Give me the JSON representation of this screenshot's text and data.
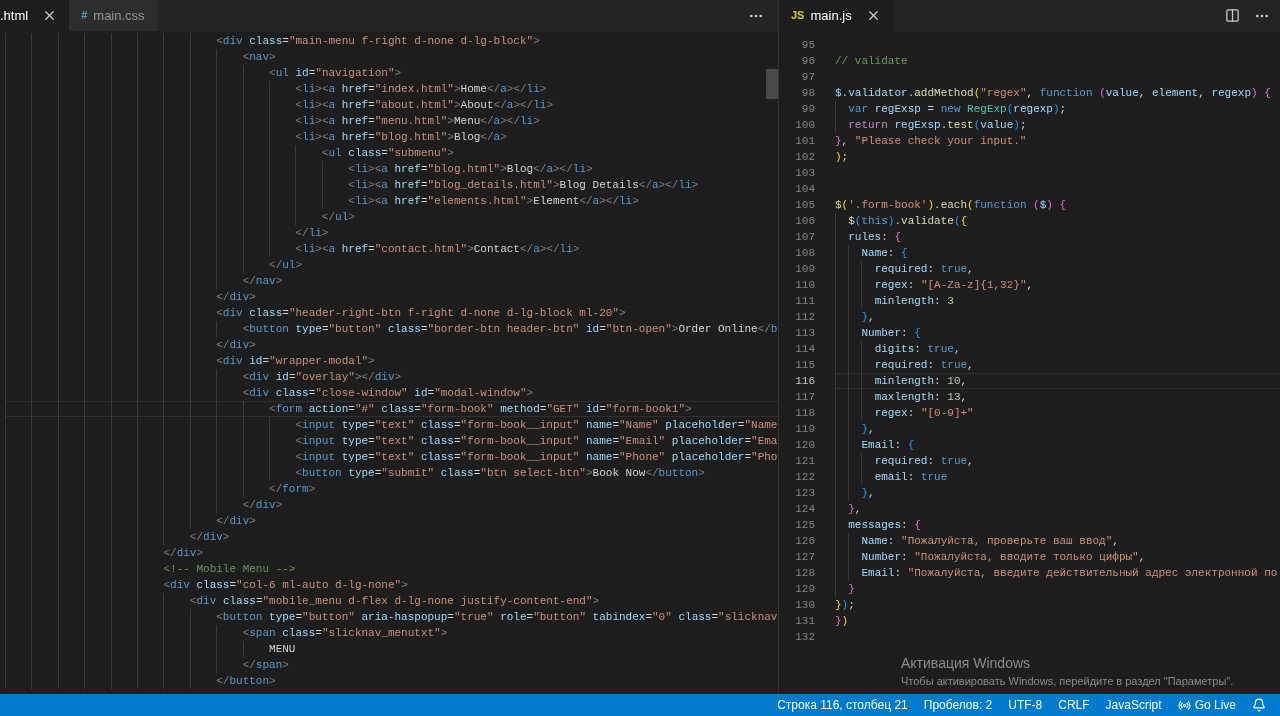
{
  "left_editor": {
    "tabs": [
      {
        "label": ".html",
        "selected": true
      },
      {
        "label": "main.css",
        "glyph": "#",
        "color": "#519aba",
        "selected": false
      }
    ],
    "lines": [
      {
        "code": "                                <div class=\"main-menu f-right d-none d-lg-block\">",
        "current": false
      },
      {
        "code": "                                    <nav>",
        "current": false
      },
      {
        "code": "                                        <ul id=\"navigation\">",
        "current": false
      },
      {
        "code": "                                            <li><a href=\"index.html\">Home</a></li>",
        "current": false
      },
      {
        "code": "                                            <li><a href=\"about.html\">About</a></li>",
        "current": false
      },
      {
        "code": "                                            <li><a href=\"menu.html\">Menu</a></li>",
        "current": false
      },
      {
        "code": "                                            <li><a href=\"blog.html\">Blog</a>",
        "current": false
      },
      {
        "code": "                                                <ul class=\"submenu\">",
        "current": false
      },
      {
        "code": "                                                    <li><a href=\"blog.html\">Blog</a></li>",
        "current": false
      },
      {
        "code": "                                                    <li><a href=\"blog_details.html\">Blog Details</a></li>",
        "current": false
      },
      {
        "code": "                                                    <li><a href=\"elements.html\">Element</a></li>",
        "current": false
      },
      {
        "code": "                                                </ul>",
        "current": false
      },
      {
        "code": "                                            </li>",
        "current": false
      },
      {
        "code": "                                            <li><a href=\"contact.html\">Contact</a></li>",
        "current": false
      },
      {
        "code": "                                        </ul>",
        "current": false
      },
      {
        "code": "                                    </nav>",
        "current": false
      },
      {
        "code": "                                </div>",
        "current": false
      },
      {
        "code": "                                <div class=\"header-right-btn f-right d-none d-lg-block ml-20\">",
        "current": false
      },
      {
        "code": "                                    <button type=\"button\" class=\"border-btn header-btn\" id=\"btn-open\">Order Online</b",
        "current": false
      },
      {
        "code": "                                </div>",
        "current": false
      },
      {
        "code": "                                <div id=\"wrapper-modal\">",
        "current": false
      },
      {
        "code": "                                    <div id=\"overlay\"></div>",
        "current": false
      },
      {
        "code": "                                    <div class=\"close-window\" id=\"modal-window\">",
        "current": false
      },
      {
        "code": "                                        <form action=\"#\" class=\"form-book\" method=\"GET\" id=\"form-book1\">",
        "current": true
      },
      {
        "code": "                                            <input type=\"text\" class=\"form-book__input\" name=\"Name\" placeholder=\"Name",
        "current": false
      },
      {
        "code": "                                            <input type=\"text\" class=\"form-book__input\" name=\"Email\" placeholder=\"Ema",
        "current": false
      },
      {
        "code": "                                            <input type=\"text\" class=\"form-book__input\" name=\"Phone\" placeholder=\"Pho",
        "current": false
      },
      {
        "code": "                                            <button type=\"submit\" class=\"btn select-btn\">Book Now</button>",
        "current": false
      },
      {
        "code": "                                        </form>",
        "current": false
      },
      {
        "code": "                                    </div>",
        "current": false
      },
      {
        "code": "                                </div>",
        "current": false
      },
      {
        "code": "                            </div>",
        "current": false
      },
      {
        "code": "                        </div>",
        "current": false
      },
      {
        "code": "                        <!-- Mobile Menu -->",
        "current": false
      },
      {
        "code": "                        <div class=\"col-6 ml-auto d-lg-none\">",
        "current": false
      },
      {
        "code": "                            <div class=\"mobile_menu d-flex d-lg-none justify-content-end\">",
        "current": false
      },
      {
        "code": "                                <button type=\"button\" aria-haspopup=\"true\" role=\"button\" tabindex=\"0\" class=\"slicknav",
        "current": false
      },
      {
        "code": "                                    <span class=\"slicknav_menutxt\">",
        "current": false
      },
      {
        "code": "                                        MENU",
        "current": false
      },
      {
        "code": "                                    </span>",
        "current": false
      },
      {
        "code": "                                </button>",
        "current": false
      }
    ]
  },
  "right_editor": {
    "tabs": [
      {
        "label": "main.js",
        "glyph": "JS",
        "color": "#cbcb41",
        "selected": true
      }
    ],
    "lines": [
      {
        "number": "95",
        "current": false
      },
      {
        "number": "96",
        "code": "// validate",
        "current": false
      },
      {
        "number": "97",
        "current": false
      },
      {
        "number": "98",
        "code": "$.validator.addMethod(\"regex\", function (value, element, regexp) {",
        "current": false
      },
      {
        "number": "99",
        "code": "  var regExsp = new RegExp(regexp);",
        "current": false
      },
      {
        "number": "100",
        "code": "  return regExsp.test(value);",
        "current": false
      },
      {
        "number": "101",
        "code": "}, \"Please check your input.\"",
        "current": false
      },
      {
        "number": "102",
        "code": ");",
        "current": false
      },
      {
        "number": "103",
        "current": false
      },
      {
        "number": "104",
        "current": false
      },
      {
        "number": "105",
        "code": "$('.form-book').each(function ($) {",
        "current": false
      },
      {
        "number": "106",
        "code": "  $(this).validate({",
        "current": false
      },
      {
        "number": "107",
        "code": "  rules: {",
        "current": false
      },
      {
        "number": "108",
        "code": "    Name: {",
        "current": false
      },
      {
        "number": "109",
        "code": "      required: true,",
        "current": false
      },
      {
        "number": "110",
        "code": "      regex: \"[A-Za-z]{1,32}\",",
        "current": false
      },
      {
        "number": "111",
        "code": "      minlength: 3",
        "current": false
      },
      {
        "number": "112",
        "code": "    },",
        "current": false
      },
      {
        "number": "113",
        "code": "    Number: {",
        "current": false
      },
      {
        "number": "114",
        "code": "      digits: true,",
        "current": false
      },
      {
        "number": "115",
        "code": "      required: true,",
        "current": false
      },
      {
        "number": "116",
        "code": "      minlength: 10,",
        "current": true
      },
      {
        "number": "117",
        "code": "      maxlength: 13,",
        "current": false
      },
      {
        "number": "118",
        "code": "      regex: \"[0-9]+\"",
        "current": false
      },
      {
        "number": "119",
        "code": "    },",
        "current": false
      },
      {
        "number": "120",
        "code": "    Email: {",
        "current": false
      },
      {
        "number": "121",
        "code": "      required: true,",
        "current": false
      },
      {
        "number": "122",
        "code": "      email: true",
        "current": false
      },
      {
        "number": "123",
        "code": "    },",
        "current": false
      },
      {
        "number": "124",
        "code": "  },",
        "current": false
      },
      {
        "number": "125",
        "code": "  messages: {",
        "current": false
      },
      {
        "number": "126",
        "code": "    Name: \"Пожалуйста, проверьте ваш ввод\",",
        "current": false
      },
      {
        "number": "127",
        "code": "    Number: \"Пожалуйста, вводите только цифры\",",
        "current": false
      },
      {
        "number": "128",
        "code": "    Email: \"Пожалуйста, введите действительный адрес электронной по",
        "current": false
      },
      {
        "number": "129",
        "code": "  }",
        "current": false
      },
      {
        "number": "130",
        "code": "});",
        "current": false
      },
      {
        "number": "131",
        "code": "})",
        "current": false
      },
      {
        "number": "132",
        "current": false
      }
    ]
  },
  "activation_notice": {
    "title": "Активация Windows",
    "text": "Чтобы активировать Windows, перейдите в раздел \"Параметры\"."
  },
  "status_bar": {
    "items": [
      {
        "kind": "text",
        "label": "Строка 116, столбец 21"
      },
      {
        "kind": "text",
        "label": "Пробелов: 2"
      },
      {
        "kind": "text",
        "label": "UTF-8"
      },
      {
        "kind": "text",
        "label": "CRLF"
      },
      {
        "kind": "text",
        "label": "JavaScript"
      },
      {
        "kind": "live",
        "label": "Go Live"
      },
      {
        "kind": "bell"
      }
    ]
  }
}
